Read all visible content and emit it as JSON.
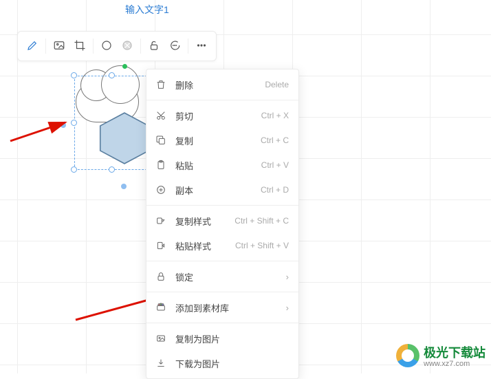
{
  "placeholder_label": "输入文字1",
  "toolbar": {
    "items": [
      {
        "name": "pen-icon"
      },
      {
        "name": "image-icon"
      },
      {
        "name": "crop-icon"
      },
      {
        "name": "circle-icon"
      },
      {
        "name": "texture-icon"
      },
      {
        "name": "unlock-icon"
      },
      {
        "name": "comment-icon"
      },
      {
        "name": "more-icon"
      }
    ]
  },
  "menu": {
    "groups": [
      [
        {
          "icon": "trash-icon",
          "label": "删除",
          "shortcut": "Delete"
        }
      ],
      [
        {
          "icon": "cut-icon",
          "label": "剪切",
          "shortcut": "Ctrl + X"
        },
        {
          "icon": "copy-icon",
          "label": "复制",
          "shortcut": "Ctrl + C"
        },
        {
          "icon": "paste-icon",
          "label": "粘贴",
          "shortcut": "Ctrl + V"
        },
        {
          "icon": "duplicate-icon",
          "label": "副本",
          "shortcut": "Ctrl + D"
        }
      ],
      [
        {
          "icon": "copy-style-icon",
          "label": "复制样式",
          "shortcut": "Ctrl + Shift + C"
        },
        {
          "icon": "paste-style-icon",
          "label": "粘贴样式",
          "shortcut": "Ctrl + Shift + V"
        }
      ],
      [
        {
          "icon": "lock-icon",
          "label": "锁定",
          "submenu": true
        }
      ],
      [
        {
          "icon": "library-icon",
          "label": "添加到素材库",
          "submenu": true
        }
      ],
      [
        {
          "icon": "copy-image-icon",
          "label": "复制为图片"
        },
        {
          "icon": "download-icon",
          "label": "下载为图片"
        }
      ]
    ]
  },
  "watermark": {
    "title": "极光下载站",
    "url": "www.xz7.com"
  }
}
